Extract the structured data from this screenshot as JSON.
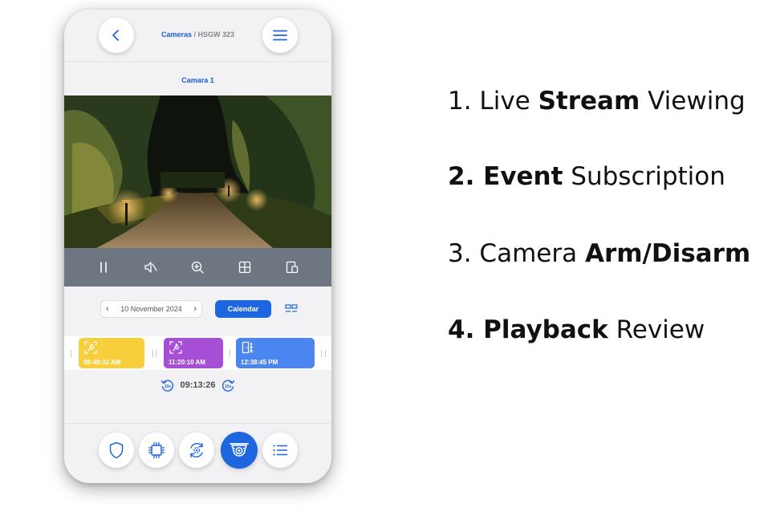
{
  "header": {
    "breadcrumb_main": "Cameras",
    "breadcrumb_separator": " / ",
    "breadcrumb_device": "HSGW 323",
    "camera_title": "Camara 1"
  },
  "video": {
    "page_index": 1,
    "controls": [
      "pause-icon",
      "mute-icon",
      "zoom-in-icon",
      "grid-view-icon",
      "snapshot-icon"
    ]
  },
  "date_selector": {
    "prev": "‹",
    "date": "10 November 2024",
    "next": "›",
    "calendar_label": "Calendar"
  },
  "events": [
    {
      "time": "08:49:32 AM",
      "icon": "motion-person-icon",
      "color": "#f7cf3c"
    },
    {
      "time": "11:20:10 AM",
      "icon": "motion-person-icon",
      "color": "#a64fd6"
    },
    {
      "time": "12:38:45 PM",
      "icon": "door-person-icon",
      "color": "#4b86f0"
    }
  ],
  "playback": {
    "time": "09:13:26",
    "rewind_label": "10s",
    "forward_label": "10s"
  },
  "bottom_nav": [
    "shield-icon",
    "chip-icon",
    "settings-sync-icon",
    "camera-icon",
    "list-icon"
  ],
  "features": [
    {
      "prefix": "1. Live ",
      "bold": "Stream",
      "suffix": " Viewing"
    },
    {
      "prefix": "",
      "bold": "2. Event",
      "suffix": " Subscription"
    },
    {
      "prefix": "3. Camera ",
      "bold": "Arm/Disarm",
      "suffix": ""
    },
    {
      "prefix": "",
      "bold": "4. Playback",
      "suffix": " Review"
    }
  ],
  "colors": {
    "accent": "#1d66e0",
    "controls_bar": "#6e7682",
    "phone_bg": "#f2f2f4"
  }
}
